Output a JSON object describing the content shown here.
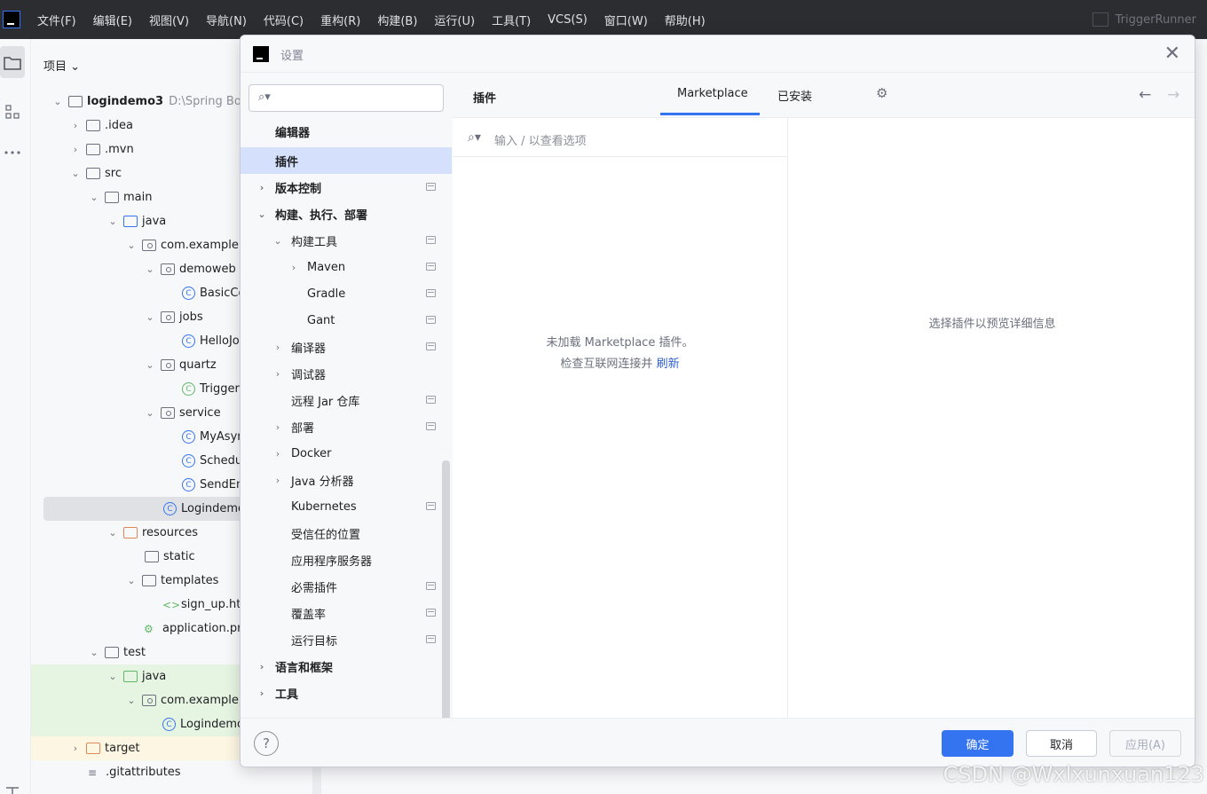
{
  "menubar": {
    "items": [
      "文件(F)",
      "编辑(E)",
      "视图(V)",
      "导航(N)",
      "代码(C)",
      "重构(R)",
      "构建(B)",
      "运行(U)",
      "工具(T)",
      "VCS(S)",
      "窗口(W)",
      "帮助(H)"
    ],
    "run_config": "TriggerRunner"
  },
  "project": {
    "header": "项目 ⌄",
    "tree": [
      {
        "label": "logindemo3",
        "extra": "D:\\Spring Boot",
        "icon": "module-folder-icon"
      },
      {
        "label": ".idea",
        "icon": "folder-icon"
      },
      {
        "label": ".mvn",
        "icon": "folder-icon"
      },
      {
        "label": "src",
        "icon": "folder-icon"
      },
      {
        "label": "main",
        "icon": "folder-icon"
      },
      {
        "label": "java",
        "icon": "source-folder-icon"
      },
      {
        "label": "com.example.lc",
        "icon": "package-icon"
      },
      {
        "label": "demoweb",
        "icon": "package-icon"
      },
      {
        "label": "BasicCo",
        "icon": "class-icon"
      },
      {
        "label": "jobs",
        "icon": "package-icon"
      },
      {
        "label": "HelloJo",
        "icon": "class-icon"
      },
      {
        "label": "quartz",
        "icon": "package-icon"
      },
      {
        "label": "Trigger",
        "icon": "class-icon"
      },
      {
        "label": "service",
        "icon": "package-icon"
      },
      {
        "label": "MyAsyn",
        "icon": "class-icon"
      },
      {
        "label": "Schedul",
        "icon": "class-icon"
      },
      {
        "label": "SendEm",
        "icon": "class-icon"
      },
      {
        "label": "Logindemo",
        "icon": "class-icon"
      },
      {
        "label": "resources",
        "icon": "resources-folder-icon"
      },
      {
        "label": "static",
        "icon": "folder-icon"
      },
      {
        "label": "templates",
        "icon": "folder-icon"
      },
      {
        "label": "sign_up.htm",
        "icon": "html-icon"
      },
      {
        "label": "application.pro",
        "icon": "properties-icon"
      },
      {
        "label": "test",
        "icon": "folder-icon"
      },
      {
        "label": "java",
        "icon": "test-folder-icon"
      },
      {
        "label": "com.example.lc",
        "icon": "package-icon"
      },
      {
        "label": "Logindemo",
        "icon": "class-icon"
      },
      {
        "label": "target",
        "icon": "excluded-folder-icon"
      },
      {
        "label": ".gitattributes",
        "icon": "file-icon"
      }
    ]
  },
  "dialog": {
    "title": "设置",
    "nav": [
      {
        "label": "编辑器",
        "bold": true
      },
      {
        "label": "插件",
        "bold": true,
        "selected": true
      },
      {
        "label": "版本控制",
        "bold": true
      },
      {
        "label": "构建、执行、部署",
        "bold": true
      },
      {
        "label": "构建工具"
      },
      {
        "label": "Maven"
      },
      {
        "label": "Gradle"
      },
      {
        "label": "Gant"
      },
      {
        "label": "编译器"
      },
      {
        "label": "调试器"
      },
      {
        "label": "远程 Jar 仓库"
      },
      {
        "label": "部署"
      },
      {
        "label": "Docker"
      },
      {
        "label": "Java 分析器"
      },
      {
        "label": "Kubernetes"
      },
      {
        "label": "受信任的位置"
      },
      {
        "label": "应用程序服务器"
      },
      {
        "label": "必需插件"
      },
      {
        "label": "覆盖率"
      },
      {
        "label": "运行目标"
      },
      {
        "label": "语言和框架",
        "bold": true
      },
      {
        "label": "工具",
        "bold": true
      }
    ],
    "section_title": "插件",
    "tabs": [
      "Marketplace",
      "已安装"
    ],
    "active_tab": "Marketplace",
    "plugin_search_placeholder": "输入 / 以查看选项",
    "empty_line1": "未加载 Marketplace 插件。",
    "empty_line2_prefix": "检查互联网连接并 ",
    "empty_line2_link": "刷新",
    "detail_hint": "选择插件以预览详细信息",
    "buttons": {
      "ok": "确定",
      "cancel": "取消",
      "apply": "应用(A)"
    },
    "help": "?"
  },
  "watermark": "CSDN @Wxlxunxuan123"
}
